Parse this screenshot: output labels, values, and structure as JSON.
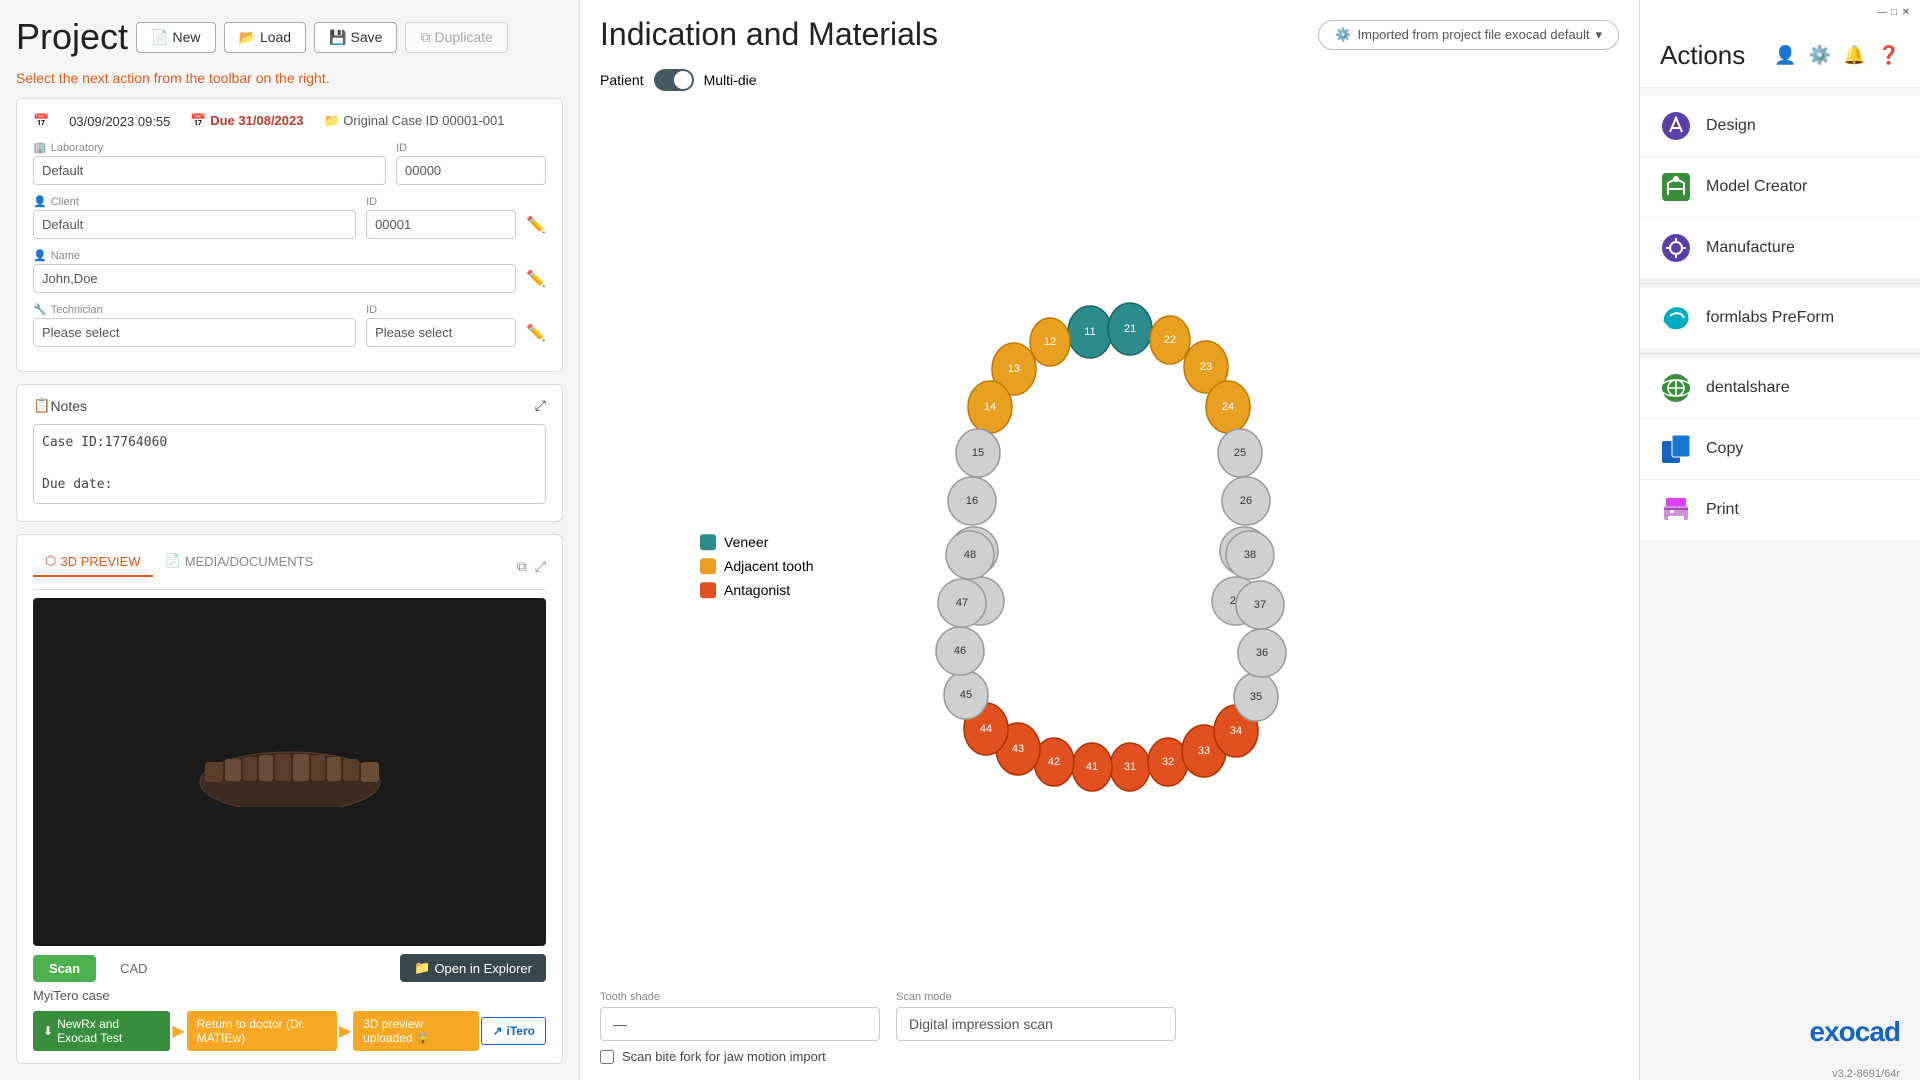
{
  "left": {
    "project_title": "Project",
    "toolbar": {
      "new_label": "New",
      "load_label": "Load",
      "save_label": "Save",
      "duplicate_label": "Duplicate"
    },
    "action_hint": "Select the next action from the toolbar on the right.",
    "info": {
      "date": "03/09/2023 09:55",
      "due_label": "Due",
      "due_date": "31/08/2023",
      "original_case_label": "Original Case ID",
      "original_case_id": "00001-001",
      "laboratory_label": "Laboratory",
      "laboratory_value": "Default",
      "laboratory_id_label": "ID",
      "laboratory_id_value": "00000",
      "client_label": "Client",
      "client_value": "Default",
      "client_id_label": "ID",
      "client_id_value": "00001",
      "name_label": "Name",
      "name_value": "John,Doe",
      "technician_label": "Technician",
      "technician_value": "Please select",
      "technician_id_label": "ID",
      "technician_id_value": "Please select"
    },
    "notes": {
      "title": "Notes",
      "content": "Case ID:17764060\n\nDue date:"
    },
    "preview": {
      "tab_3d": "3D PREVIEW",
      "tab_media": "MEDIA/DOCUMENTS",
      "scan_btn": "Scan",
      "cad_btn": "CAD",
      "open_explorer_btn": "Open in Explorer",
      "case_name": "MyiTero case",
      "wf_step1": "NewRx and Exocad Test",
      "wf_step2": "Return to doctor (Dr. MATIEw)",
      "wf_step3": "3D preview uploaded 🔒",
      "wf_itero": "iTero"
    }
  },
  "middle": {
    "title": "Indication and Materials",
    "import_btn": "Imported from project file exocad default",
    "patient_label": "Patient",
    "multi_die_label": "Multi-die",
    "legend": {
      "veneer": "Veneer",
      "adjacent": "Adjacent tooth",
      "antagonist": "Antagonist"
    },
    "tooth_shade_label": "Tooth shade",
    "tooth_shade_value": "—",
    "scan_mode_label": "Scan mode",
    "scan_mode_value": "Digital impression scan",
    "scan_bite_label": "Scan bite fork for jaw motion import"
  },
  "right": {
    "title": "Actions",
    "items": [
      {
        "label": "Design",
        "icon": "design-icon",
        "color": "#5B3FA6"
      },
      {
        "label": "Model Creator",
        "icon": "model-creator-icon",
        "color": "#388e3c"
      },
      {
        "label": "Manufacture",
        "icon": "manufacture-icon",
        "color": "#5B3FA6"
      },
      {
        "label": "formlabs PreForm",
        "icon": "formlabs-icon",
        "color": "#00acc1"
      },
      {
        "label": "dentalshare",
        "icon": "dentalshare-icon",
        "color": "#388e3c"
      },
      {
        "label": "Copy",
        "icon": "copy-icon",
        "color": "#1565c0"
      },
      {
        "label": "Print",
        "icon": "print-icon",
        "color": "#e040fb"
      }
    ],
    "logo": "exocad",
    "version": "v3.2-8691/64r"
  },
  "window": {
    "minimize": "—",
    "maximize": "□",
    "close": "✕"
  }
}
